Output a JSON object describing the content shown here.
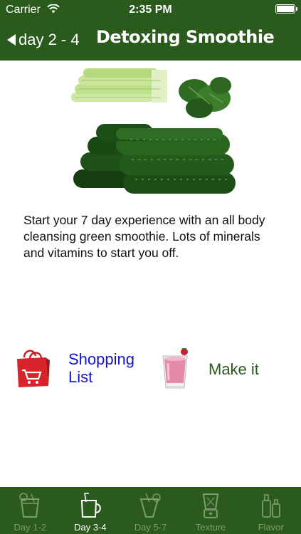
{
  "status_bar": {
    "carrier": "Carrier",
    "time": "2:35 PM"
  },
  "nav": {
    "back_label": "day 2 - 4",
    "title": "Detoxing Smoothie"
  },
  "description": "Start your 7 day experience with an all body cleansing green smoothie. Lots of minerals and vitamins to start you off.",
  "actions": {
    "shopping_label": "Shopping List",
    "makeit_label": "Make it"
  },
  "tabs": [
    {
      "label": "Day 1-2",
      "icon": "juice-glass-icon",
      "active": false
    },
    {
      "label": "Day 3-4",
      "icon": "mug-straw-icon",
      "active": true
    },
    {
      "label": "Day 5-7",
      "icon": "cocktail-glass-icon",
      "active": false
    },
    {
      "label": "Texture",
      "icon": "blender-icon",
      "active": false
    },
    {
      "label": "Flavor",
      "icon": "bottles-icon",
      "active": false
    }
  ],
  "colors": {
    "brand_green": "#2a5a1c",
    "link_blue": "#1515c8",
    "tab_inactive": "#7c9c6f"
  }
}
